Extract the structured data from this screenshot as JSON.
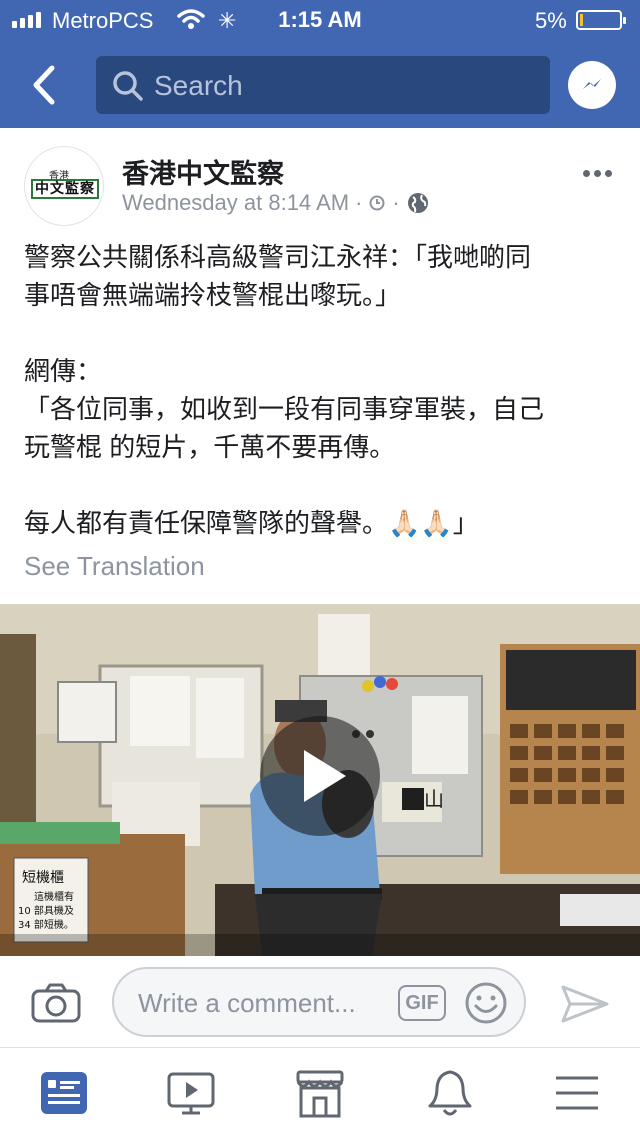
{
  "status_bar": {
    "carrier": "MetroPCS",
    "time": "1:15 AM",
    "battery_percent": "5%",
    "battery_level": 0.05
  },
  "nav": {
    "search_placeholder": "Search",
    "back_icon": "chevron-left-icon",
    "messenger_icon": "messenger-icon"
  },
  "post": {
    "page_name": "香港中文監察",
    "timestamp": "Wednesday at 8:14 AM",
    "avatar_logo": {
      "small": "香港",
      "main": "中文監察"
    },
    "text_lines": [
      [
        "警察公共關係科高級警司江永祥：「我哋啲同",
        "事唔會無端端拎枝警棍出嚟玩。」"
      ],
      [
        "網傳：",
        "「各位同事，如收到一段有同事穿軍裝，自己",
        "玩警棍 的短片，千萬不要再傳。"
      ],
      [
        "每人都有責任保障警隊的聲譽。🙏🏻🙏🏻」"
      ]
    ],
    "see_translation": "See Translation",
    "video_sign": {
      "title": "短機櫃",
      "line1": "這機櫃有",
      "line2": "10 部具機及",
      "line3": "34 部短機。"
    },
    "panel_label": "山山"
  },
  "comment_bar": {
    "placeholder": "Write a comment...",
    "gif_label": "GIF"
  },
  "tab_bar": {
    "tabs": [
      "news-feed-icon",
      "watch-icon",
      "marketplace-icon",
      "notifications-icon",
      "menu-icon"
    ],
    "active": "news-feed-icon"
  },
  "colors": {
    "brand_blue": "#4267b2",
    "search_bg": "#29487d",
    "secondary_text": "#8d949e",
    "battery_low": "#f7c12c"
  }
}
